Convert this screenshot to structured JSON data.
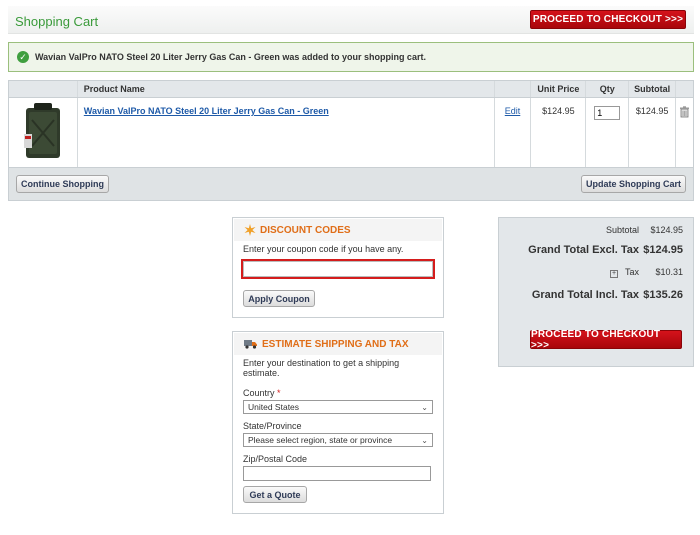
{
  "header": {
    "title": "Shopping Cart",
    "checkout_label": "PROCEED TO CHECKOUT  >>>"
  },
  "message": {
    "text": "Wavian ValPro NATO Steel 20 Liter Jerry Gas Can - Green was added to your shopping cart."
  },
  "cart": {
    "columns": [
      "",
      "Product Name",
      "",
      "Unit Price",
      "Qty",
      "Subtotal",
      ""
    ],
    "items": [
      {
        "name": "Wavian ValPro NATO Steel 20 Liter Jerry Gas Can - Green",
        "edit_label": "Edit",
        "unit_price": "$124.95",
        "qty": "1",
        "subtotal": "$124.95"
      }
    ],
    "continue_label": "Continue Shopping",
    "update_label": "Update Shopping Cart"
  },
  "discount": {
    "title": "DISCOUNT CODES",
    "description": "Enter your coupon code if you have any.",
    "coupon_value": "",
    "apply_label": "Apply Coupon"
  },
  "shipping": {
    "title": "ESTIMATE SHIPPING AND TAX",
    "description": "Enter your destination to get a shipping estimate.",
    "country_label": "Country",
    "country_required": "*",
    "country_value": "United States",
    "state_label": "State/Province",
    "state_value": "Please select region, state or province",
    "zip_label": "Zip/Postal Code",
    "zip_value": "",
    "quote_label": "Get a Quote"
  },
  "totals": {
    "subtotal_label": "Subtotal",
    "subtotal_value": "$124.95",
    "grand_excl_label": "Grand Total Excl. Tax",
    "grand_excl_value": "$124.95",
    "tax_label": "Tax",
    "tax_value": "$10.31",
    "grand_incl_label": "Grand Total Incl. Tax",
    "grand_incl_value": "$135.26",
    "checkout_label": "PROCEED TO CHECKOUT  >>>"
  },
  "colors": {
    "accent_green": "#3a9a3a",
    "checkout_red": "#c10c14",
    "link_blue": "#1e5aa8",
    "section_orange": "#e06e18"
  },
  "icons": [
    "check-icon",
    "gas-can-image",
    "trash-icon",
    "discount-star-icon",
    "truck-icon",
    "chevron-down-icon",
    "plus-box-icon"
  ]
}
